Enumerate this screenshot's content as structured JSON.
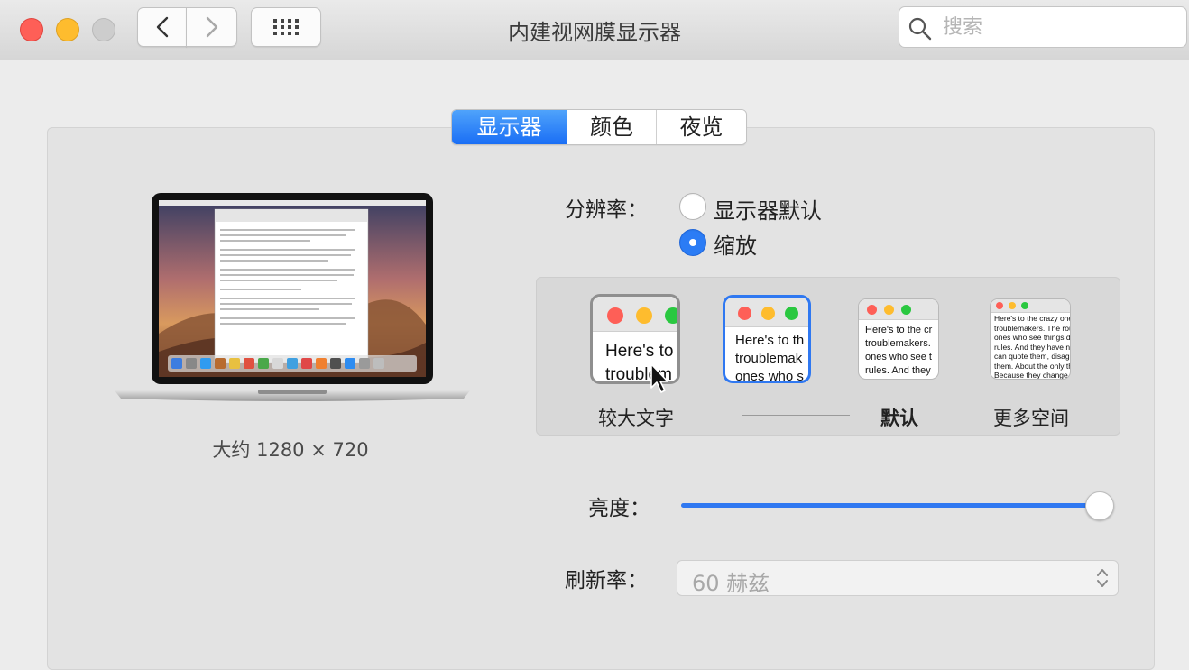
{
  "window": {
    "title": "内建视网膜显示器"
  },
  "search": {
    "placeholder": "搜索"
  },
  "tabs": [
    {
      "label": "显示器",
      "selected": true
    },
    {
      "label": "颜色",
      "selected": false
    },
    {
      "label": "夜览",
      "selected": false
    }
  ],
  "preview": {
    "caption": "大约 1280 × 720"
  },
  "resolution": {
    "label": "分辨率：",
    "options": [
      {
        "label": "显示器默认",
        "selected": false
      },
      {
        "label": "缩放",
        "selected": true
      }
    ]
  },
  "scaling": {
    "sample_text": "Here's to the crazy ones troublemakers. The ones who see things differently. They're not fond of rules. And they have no respect for the status quo. You can quote them, disagree with them. About the only thing you can't do is ignore them. Because they change things.",
    "options": [
      {
        "label": "较大文字",
        "lines": [
          "Here's to",
          "troublem"
        ]
      },
      {
        "label": "",
        "lines": [
          "Here's to th",
          "troublemak",
          "ones who s"
        ],
        "selected": true
      },
      {
        "label": "默认",
        "lines": [
          "Here's to the cr",
          "troublemakers.",
          "ones who see t",
          "rules. And they"
        ]
      },
      {
        "label": "更多空间",
        "lines": [
          "Here's to the crazy ones",
          "troublemakers. The rou",
          "ones who see things di",
          "rules. And they have no",
          "can quote them, disagre",
          "them. About the only th",
          "Because they change th"
        ]
      }
    ]
  },
  "brightness": {
    "label": "亮度：",
    "value": 0.97
  },
  "refresh": {
    "label": "刷新率：",
    "value": "60 赫兹"
  },
  "colors": {
    "accent": "#2f78f1",
    "close": "#fe5f57",
    "minimize": "#febc2e",
    "zoom_green": "#2ac840"
  }
}
